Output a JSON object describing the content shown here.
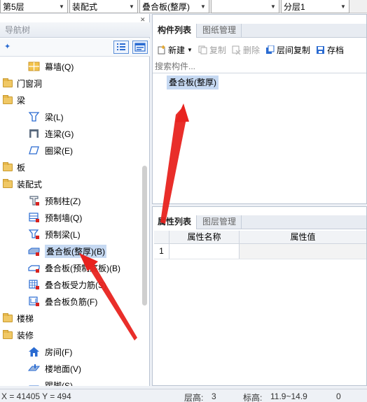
{
  "top_dropdowns": [
    {
      "value": "第5层"
    },
    {
      "value": "装配式"
    },
    {
      "value": "叠合板(整厚)"
    },
    {
      "value": ""
    },
    {
      "value": "分层1"
    }
  ],
  "nav": {
    "title": "导航树",
    "tree": [
      {
        "label": "幕墙(Q)",
        "level": 1,
        "icon": "curtain-wall-icon"
      },
      {
        "label": "门窗洞",
        "level": 0,
        "icon": "folder-icon"
      },
      {
        "label": "梁",
        "level": 0,
        "icon": "folder-icon"
      },
      {
        "label": "梁(L)",
        "level": 1,
        "icon": "beam-icon"
      },
      {
        "label": "连梁(G)",
        "level": 1,
        "icon": "link-beam-icon"
      },
      {
        "label": "圈梁(E)",
        "level": 1,
        "icon": "ring-beam-icon"
      },
      {
        "label": "板",
        "level": 0,
        "icon": "folder-icon"
      },
      {
        "label": "装配式",
        "level": 0,
        "icon": "folder-icon"
      },
      {
        "label": "预制柱(Z)",
        "level": 1,
        "icon": "precast-column-icon"
      },
      {
        "label": "预制墙(Q)",
        "level": 1,
        "icon": "precast-wall-icon"
      },
      {
        "label": "预制梁(L)",
        "level": 1,
        "icon": "precast-beam-icon"
      },
      {
        "label": "叠合板(整厚)(B)",
        "level": 1,
        "icon": "slab-icon",
        "selected": true
      },
      {
        "label": "叠合板(预制底板)(B)",
        "level": 1,
        "icon": "slab-base-icon"
      },
      {
        "label": "叠合板受力筋(S)",
        "level": 1,
        "icon": "slab-rebar-icon"
      },
      {
        "label": "叠合板负筋(F)",
        "level": 1,
        "icon": "slab-negative-rebar-icon"
      },
      {
        "label": "楼梯",
        "level": 0,
        "icon": "folder-icon"
      },
      {
        "label": "装修",
        "level": 0,
        "icon": "folder-icon"
      },
      {
        "label": "房间(F)",
        "level": 1,
        "icon": "room-icon"
      },
      {
        "label": "楼地面(V)",
        "level": 1,
        "icon": "floor-icon"
      },
      {
        "label": "踢脚(S)",
        "level": 1,
        "icon": "skirting-icon"
      }
    ]
  },
  "component_panel": {
    "tabs": [
      "构件列表",
      "图纸管理"
    ],
    "toolbar": {
      "new": "新建",
      "copy": "复制",
      "delete": "删除",
      "floor_copy": "层间复制",
      "archive": "存档"
    },
    "search_placeholder": "搜索构件...",
    "items": [
      "叠合板(整厚)"
    ]
  },
  "property_panel": {
    "tabs": [
      "属性列表",
      "图层管理"
    ],
    "columns": [
      "属性名称",
      "属性值"
    ],
    "rows": [
      {
        "index": "1",
        "name": "",
        "value": ""
      }
    ]
  },
  "status": {
    "coords": "X = 41405 Y = 494",
    "floor_height_label": "层高:",
    "floor_height_value": "3",
    "elevation_label": "标高:",
    "elevation_value": "11.9~14.9",
    "extra": "0"
  },
  "colors": {
    "selection": "#c6d9f2",
    "folder": "#f0c865",
    "accent_blue": "#2a6bd1",
    "annotation_red": "#e8231f"
  }
}
